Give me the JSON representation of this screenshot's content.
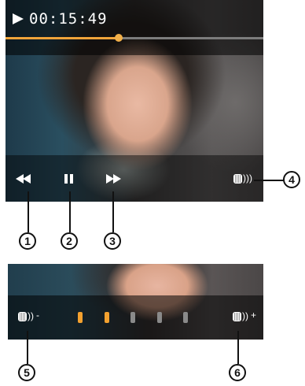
{
  "player": {
    "status_icon": "play-icon",
    "time": "00:15:49",
    "progress_percent": 44,
    "colors": {
      "progress": "#f0a43a",
      "track": "#7c7c7c"
    },
    "controls": [
      {
        "icon": "rewind-icon"
      },
      {
        "icon": "pause-icon"
      },
      {
        "icon": "fast-forward-icon"
      }
    ],
    "volume_icon": "speaker-icon"
  },
  "volume_screen": {
    "minus_label": "-",
    "plus_label": "+",
    "level": 2,
    "segments": 5,
    "colors": {
      "on": "#f3a12f",
      "off": "#8a8a8a"
    }
  },
  "callouts": [
    "1",
    "2",
    "3",
    "4",
    "5",
    "6"
  ]
}
